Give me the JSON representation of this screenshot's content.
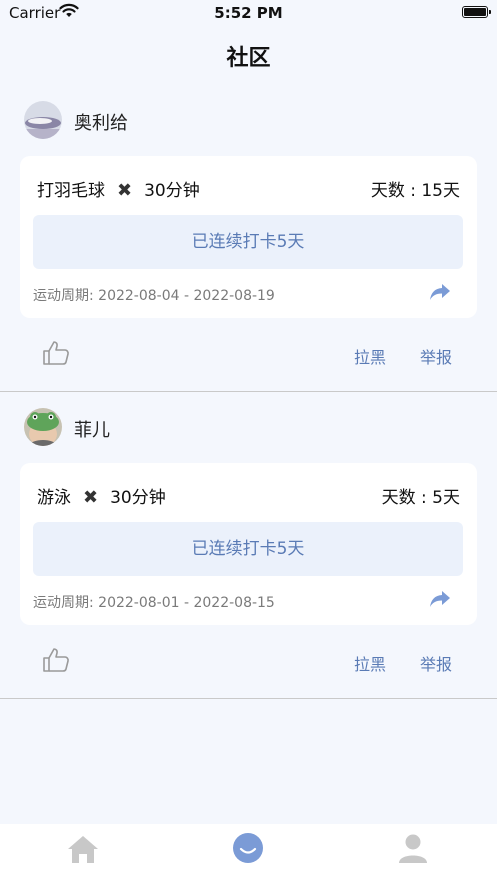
{
  "status": {
    "carrier": "Carrier",
    "time": "5:52 PM"
  },
  "header": {
    "title": "社区"
  },
  "posts": [
    {
      "user": "奥利给",
      "activity": "打羽毛球",
      "duration": "30分钟",
      "days": "天数 : 15天",
      "streak": "已连续打卡5天",
      "period": "运动周期: 2022-08-04 - 2022-08-19",
      "block": "拉黑",
      "report": "举报"
    },
    {
      "user": "菲儿",
      "activity": "游泳",
      "duration": "30分钟",
      "days": "天数 : 5天",
      "streak": "已连续打卡5天",
      "period": "运动周期: 2022-08-01 - 2022-08-15",
      "block": "拉黑",
      "report": "举报"
    }
  ],
  "colors": {
    "accent": "#5a7bb5",
    "tab_active": "#7b9bd6",
    "tab_inactive": "#c8c8c8",
    "background": "#f4f7fd"
  },
  "tabs": [
    {
      "icon": "home-icon",
      "active": false
    },
    {
      "icon": "smile-icon",
      "active": true
    },
    {
      "icon": "profile-icon",
      "active": false
    }
  ]
}
